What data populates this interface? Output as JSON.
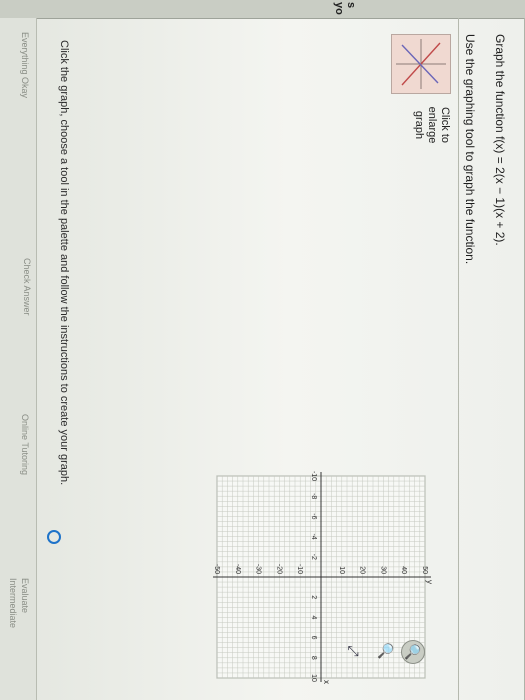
{
  "question": {
    "prompt": "Graph the function f(x) = 2(x − 1)(x + 2).",
    "instruction": "Use the graphing tool to graph the function."
  },
  "left_strip": {
    "cut_text": "s yo"
  },
  "enlarge_link": {
    "line1": "Click to",
    "line2": "enlarge",
    "line3": "graph"
  },
  "graph": {
    "x_ticks": [
      "-10",
      "-8",
      "-6",
      "-4",
      "-2",
      "2",
      "4",
      "6",
      "8",
      "10"
    ],
    "y_ticks": [
      "50",
      "40",
      "30",
      "20",
      "10",
      "-10",
      "-20",
      "-30",
      "-40",
      "-50"
    ],
    "x_axis_label": "x",
    "y_axis_label": "y",
    "xlim": [
      -10,
      10
    ],
    "ylim": [
      -50,
      50
    ]
  },
  "tools": [
    {
      "name": "zoom-in",
      "glyph": "🔍"
    },
    {
      "name": "zoom-out",
      "glyph": "🔍"
    },
    {
      "name": "open-window",
      "glyph": "⤢"
    }
  ],
  "instructions_text": "Click the graph, choose a tool in the palette and follow the instructions to create your graph.",
  "footer_links": [
    "Everything Okay",
    "Check Answer",
    "Online Tutoring",
    "Evaluate",
    "Intermediate"
  ]
}
